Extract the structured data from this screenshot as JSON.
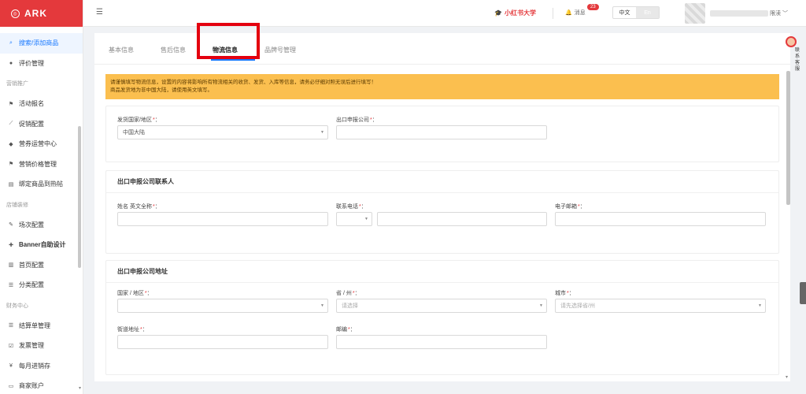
{
  "app": {
    "logo": "ARK"
  },
  "sidebar": {
    "items": [
      {
        "label": "搜索/添加商品",
        "icon": "search-icon",
        "glyph": "⌕",
        "active": true
      },
      {
        "label": "评价管理",
        "icon": "comment-icon",
        "glyph": "●"
      },
      {
        "group": "营销推广"
      },
      {
        "label": "活动报名",
        "icon": "flag-icon",
        "glyph": "⚑"
      },
      {
        "label": "促销配置",
        "icon": "chart-icon",
        "glyph": "⟋"
      },
      {
        "label": "营券运营中心",
        "icon": "tag-icon",
        "glyph": "◆"
      },
      {
        "label": "营销价格管理",
        "icon": "flag-icon",
        "glyph": "⚑"
      },
      {
        "label": "绑定商品到热帖",
        "icon": "note-icon",
        "glyph": "▤"
      },
      {
        "group": "店铺装修"
      },
      {
        "label": "场次配置",
        "icon": "edit-icon",
        "glyph": "✎"
      },
      {
        "label": "Banner自助设计",
        "icon": "puzzle-icon",
        "glyph": "✚",
        "bold": true
      },
      {
        "label": "首页配置",
        "icon": "layout-icon",
        "glyph": "▥"
      },
      {
        "label": "分类配置",
        "icon": "list-icon",
        "glyph": "☰"
      },
      {
        "group": "财务中心"
      },
      {
        "label": "结算单管理",
        "icon": "list-icon",
        "glyph": "☰"
      },
      {
        "label": "发票管理",
        "icon": "checkbox-icon",
        "glyph": "☑"
      },
      {
        "label": "每月进销存",
        "icon": "yen-icon",
        "glyph": "¥"
      },
      {
        "label": "商家账户",
        "icon": "card-icon",
        "glyph": "▭"
      }
    ]
  },
  "header": {
    "brand": "小红书大学",
    "messages_label": "消息",
    "messages_count": "23",
    "lang_zh": "中文",
    "lang_en": "En",
    "user_suffix": "限渎 ﹀"
  },
  "tabs": [
    {
      "label": "基本信息"
    },
    {
      "label": "售后信息"
    },
    {
      "label": "物流信息",
      "active": true
    },
    {
      "label": "品牌号管理"
    }
  ],
  "notice": {
    "line1": "请谨慎填写物流信息，设置的内容将影响所有物流相关的收货、发货、入库等信息，请务必仔细对照无误后进行填写！",
    "line2": "商品发货地为非中国大陆，请使用英文填写。"
  },
  "section1": {
    "origin_label": "发货国家/地区",
    "origin_value": "中国大陆",
    "export_company_label": "出口申报公司"
  },
  "section2": {
    "title": "出口申报公司联系人",
    "name_label": "姓名 英文全称",
    "phone_label": "联系电话",
    "email_label": "电子邮箱"
  },
  "section3": {
    "title": "出口申报公司地址",
    "country_label": "国家 / 地区",
    "province_label": "省 / 州",
    "province_placeholder": "请选择",
    "city_label": "城市",
    "city_placeholder": "请先选择省/州",
    "street_label": "街道地址",
    "zip_label": "邮编"
  },
  "service": {
    "label": "联系客服"
  }
}
